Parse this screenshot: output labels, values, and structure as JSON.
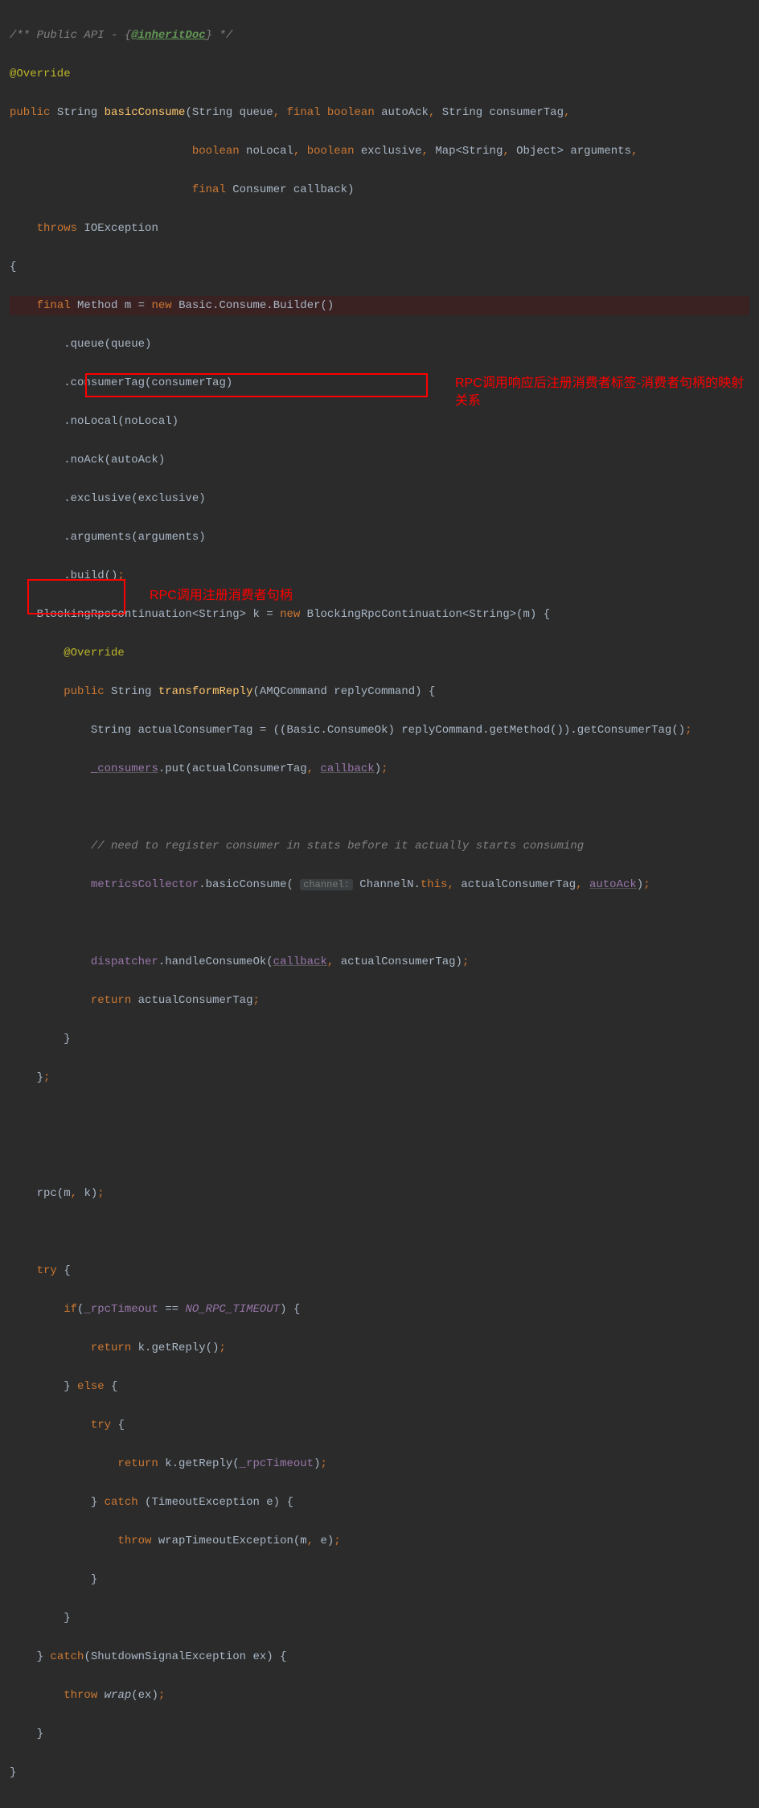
{
  "code": {
    "l1_comment_pre": "/** Public API - {",
    "l1_doctag": "@inheritDoc",
    "l1_comment_post": "} */",
    "l2_annotation": "@Override",
    "l3_public": "public",
    "l3_type": " String ",
    "l3_method": "basicConsume",
    "l3_sig1": "(String queue",
    "l3_comma1": ", ",
    "l3_final": "final boolean",
    "l3_sig2": " autoAck",
    "l3_comma2": ", ",
    "l3_sig3": "String consumerTag",
    "l3_comma3": ",",
    "l4_boolean1": "boolean",
    "l4_sig1": " noLocal",
    "l4_comma1": ", ",
    "l4_boolean2": "boolean",
    "l4_sig2": " exclusive",
    "l4_comma2": ", ",
    "l4_sig3": "Map<String",
    "l4_comma3": ", ",
    "l4_sig4": "Object> arguments",
    "l4_comma4": ",",
    "l5_final": "final",
    "l5_sig": " Consumer callback)",
    "l6_throws": "throws",
    "l6_exc": " IOException",
    "l7_brace": "{",
    "l8_final": "final",
    "l8_type": " Method m = ",
    "l8_new": "new",
    "l8_rest": " Basic.Consume.Builder()",
    "l9": "        .queue(queue)",
    "l10": "        .consumerTag(consumerTag)",
    "l11": "        .noLocal(noLocal)",
    "l12": "        .noAck(autoAck)",
    "l13": "        .exclusive(exclusive)",
    "l14": "        .arguments(arguments)",
    "l15": "        .build()",
    "l15_semi": ";",
    "l16_pre": "    BlockingRpcContinuation<String> k = ",
    "l16_new": "new",
    "l16_post": " BlockingRpcContinuation<String>(m) {",
    "l17_ann": "@Override",
    "l18_public": "public",
    "l18_type": " String ",
    "l18_method": "transformReply",
    "l18_sig": "(AMQCommand replyCommand) {",
    "l19_pre": "            String actualConsumerTag = ((Basic.ConsumeOk) replyCommand.getMethod()).getConsumerTag()",
    "l19_semi": ";",
    "l20_field": "_consumers",
    "l20_method": ".put(actualConsumerTag",
    "l20_comma": ", ",
    "l20_cb": "callback",
    "l20_end": ")",
    "l20_semi": ";",
    "l22_comment": "// need to register consumer in stats before it actually starts consuming",
    "l23_field": "metricsCollector",
    "l23_method": ".basicConsume( ",
    "l23_hint": "channel:",
    "l23_mid": " ChannelN.",
    "l23_this": "this",
    "l23_comma1": ", ",
    "l23_arg2": "actualConsumerTag",
    "l23_comma2": ", ",
    "l23_arg3": "autoAck",
    "l23_end": ")",
    "l23_semi": ";",
    "l25_field": "dispatcher",
    "l25_method": ".handleConsumeOk(",
    "l25_cb": "callback",
    "l25_comma": ", ",
    "l25_arg": "actualConsumerTag)",
    "l25_semi": ";",
    "l26_return": "return",
    "l26_val": " actualConsumerTag",
    "l26_semi": ";",
    "l27_brace": "        }",
    "l28_brace": "    }",
    "l28_semi": ";",
    "l31_call": "    rpc(m",
    "l31_comma": ", ",
    "l31_arg": "k)",
    "l31_semi": ";",
    "l33_try": "try",
    "l33_brace": " {",
    "l34_if": "if",
    "l34_pre": "(",
    "l34_field": "_rpcTimeout",
    "l34_op": " == ",
    "l34_const": "NO_RPC_TIMEOUT",
    "l34_post": ") {",
    "l35_return": "return",
    "l35_val": " k.getReply()",
    "l35_semi": ";",
    "l36_brace": "        } ",
    "l36_else": "else",
    "l36_brace2": " {",
    "l37_try": "try",
    "l37_brace": " {",
    "l38_return": "return",
    "l38_val": " k.getReply(",
    "l38_field": "_rpcTimeout",
    "l38_end": ")",
    "l38_semi": ";",
    "l39_brace": "            } ",
    "l39_catch": "catch",
    "l39_sig": " (TimeoutException e) {",
    "l40_throw": "throw",
    "l40_val": " wrapTimeoutException(m",
    "l40_comma": ", ",
    "l40_arg": "e)",
    "l40_semi": ";",
    "l41_brace": "            }",
    "l42_brace": "        }",
    "l43_brace": "    } ",
    "l43_catch": "catch",
    "l43_sig": "(ShutdownSignalException ex) {",
    "l44_throw": "throw",
    "l44_method": " wrap",
    "l44_val": "(ex)",
    "l44_semi": ";",
    "l45_brace": "    }",
    "l46_brace": "}"
  },
  "annotations": {
    "box1_text": "RPC调用响应后注册消费者标签-消费者句柄的映射关系",
    "box2_text": "RPC调用注册消费者句柄"
  }
}
